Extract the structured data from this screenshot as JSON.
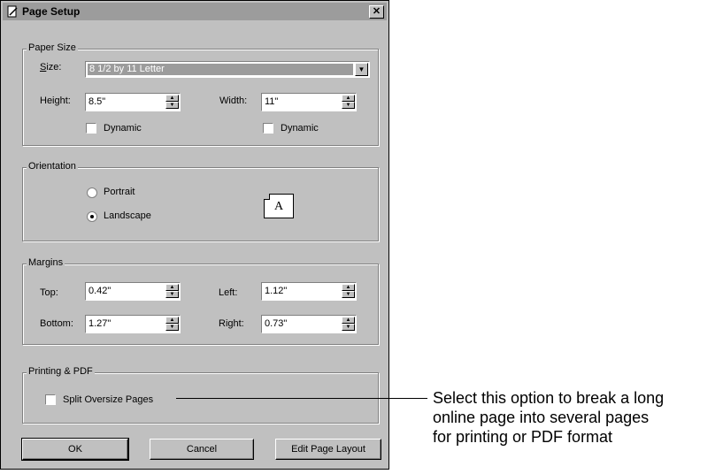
{
  "dialog": {
    "title": "Page Setup",
    "close_glyph": "✕"
  },
  "paper_size": {
    "legend": "Paper Size",
    "size_label": "Size:",
    "size_value": "8 1/2 by 11 Letter",
    "height_label": "Height:",
    "height_value": "8.5\"",
    "width_label": "Width:",
    "width_value": "11\"",
    "dynamic_height_label": "Dynamic",
    "dynamic_width_label": "Dynamic"
  },
  "orientation": {
    "legend": "Orientation",
    "portrait_label": "Portrait",
    "landscape_label": "Landscape",
    "selected": "Landscape",
    "preview_letter": "A"
  },
  "margins": {
    "legend": "Margins",
    "top_label": "Top:",
    "top_value": "0.42\"",
    "left_label": "Left:",
    "left_value": "1.12\"",
    "bottom_label": "Bottom:",
    "bottom_value": "1.27\"",
    "right_label": "Right:",
    "right_value": "0.73\""
  },
  "printing": {
    "legend": "Printing & PDF",
    "split_label": "Split Oversize Pages"
  },
  "buttons": {
    "ok": "OK",
    "cancel": "Cancel",
    "edit_layout": "Edit Page Layout"
  },
  "callout": {
    "line1": "Select this option to break a long",
    "line2": "online page into several pages",
    "line3": "for printing or PDF format"
  }
}
